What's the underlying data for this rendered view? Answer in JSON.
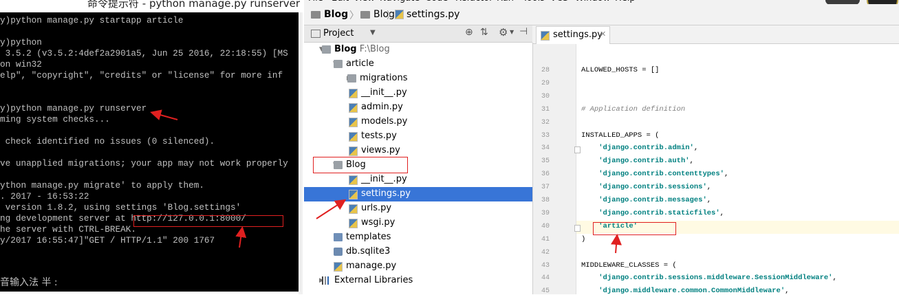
{
  "cmd": {
    "title": "命令提示符 - python  manage.py runserver",
    "lines": [
      "y)python manage.py startapp article",
      "",
      "y)python",
      " 3.5.2 (v3.5.2:4def2a2901a5, Jun 25 2016, 22:18:55) [MS",
      "on win32",
      "elp\", \"copyright\", \"credits\" or \"license\" for more inf",
      "",
      "",
      "y)python manage.py runserver",
      "ming system checks...",
      "",
      " check identified no issues (0 silenced).",
      "",
      "ve unapplied migrations; your app may not work properly",
      "",
      "ython manage.py migrate' to apply them.",
      ". 2017 - 16:53:22",
      " version 1.8.2, using settings 'Blog.settings'",
      "ng development server at http://127.0.0.1:8000/",
      "he server with CTRL-BREAK.",
      "y/2017 16:55:47]\"GET / HTTP/1.1\" 200 1767"
    ],
    "ime_status": "音输入法 半 :"
  },
  "ide": {
    "menu": [
      "File",
      "Edit",
      "View",
      "Navigate",
      "Code",
      "Refactor",
      "Run",
      "Tools",
      "VCS",
      "Window",
      "Help"
    ],
    "breadcrumb": [
      "Blog",
      "Blog",
      "settings.py"
    ],
    "project_panel": {
      "title": "Project",
      "tree": [
        {
          "label": "Blog",
          "extra": "F:\\Blog",
          "icon": "folder-icon",
          "depth": 0,
          "expanded": true
        },
        {
          "label": "article",
          "icon": "folder-icon",
          "depth": 1,
          "expanded": true
        },
        {
          "label": "migrations",
          "icon": "folder-icon",
          "depth": 2,
          "expanded": false
        },
        {
          "label": "__init__.py",
          "icon": "python-file-icon",
          "depth": 2
        },
        {
          "label": "admin.py",
          "icon": "python-file-icon",
          "depth": 2
        },
        {
          "label": "models.py",
          "icon": "python-file-icon",
          "depth": 2
        },
        {
          "label": "tests.py",
          "icon": "python-file-icon",
          "depth": 2
        },
        {
          "label": "views.py",
          "icon": "python-file-icon",
          "depth": 2
        },
        {
          "label": "Blog",
          "icon": "folder-icon",
          "depth": 1,
          "expanded": true
        },
        {
          "label": "__init__.py",
          "icon": "python-file-icon",
          "depth": 2
        },
        {
          "label": "settings.py",
          "icon": "python-file-icon",
          "depth": 2,
          "selected": true
        },
        {
          "label": "urls.py",
          "icon": "python-file-icon",
          "depth": 2
        },
        {
          "label": "wsgi.py",
          "icon": "python-file-icon",
          "depth": 2
        },
        {
          "label": "templates",
          "icon": "templates-folder-icon",
          "depth": 1
        },
        {
          "label": "db.sqlite3",
          "icon": "database-icon",
          "depth": 1
        },
        {
          "label": "manage.py",
          "icon": "python-file-icon",
          "depth": 1
        },
        {
          "label": "External Libraries",
          "icon": "libraries-icon",
          "depth": 0,
          "expanded": false
        }
      ]
    },
    "editor": {
      "tab_label": "settings.py",
      "lines": [
        {
          "n": "28",
          "text": "ALLOWED_HOSTS = []"
        },
        {
          "n": "29",
          "text": ""
        },
        {
          "n": "30",
          "text": ""
        },
        {
          "n": "31",
          "text": "# Application definition"
        },
        {
          "n": "32",
          "text": ""
        },
        {
          "n": "33",
          "text": "INSTALLED_APPS = ("
        },
        {
          "n": "34",
          "text": "    'django.contrib.admin',"
        },
        {
          "n": "35",
          "text": "    'django.contrib.auth',"
        },
        {
          "n": "36",
          "text": "    'django.contrib.contenttypes',"
        },
        {
          "n": "37",
          "text": "    'django.contrib.sessions',"
        },
        {
          "n": "38",
          "text": "    'django.contrib.messages',"
        },
        {
          "n": "39",
          "text": "    'django.contrib.staticfiles',"
        },
        {
          "n": "40",
          "text": "    'article'"
        },
        {
          "n": "41",
          "text": ")"
        },
        {
          "n": "42",
          "text": ""
        },
        {
          "n": "43",
          "text": "MIDDLEWARE_CLASSES = ("
        },
        {
          "n": "44",
          "text": "    'django.contrib.sessions.middleware.SessionMiddleware',"
        },
        {
          "n": "45",
          "text": "    'django.middleware.common.CommonMiddleware',"
        }
      ]
    }
  },
  "colors": {
    "terminal_bg": "#000000",
    "terminal_text": "#c0c0c0",
    "selection": "#3875d7",
    "annotation_red": "#e02020",
    "string_teal": "#008080"
  }
}
